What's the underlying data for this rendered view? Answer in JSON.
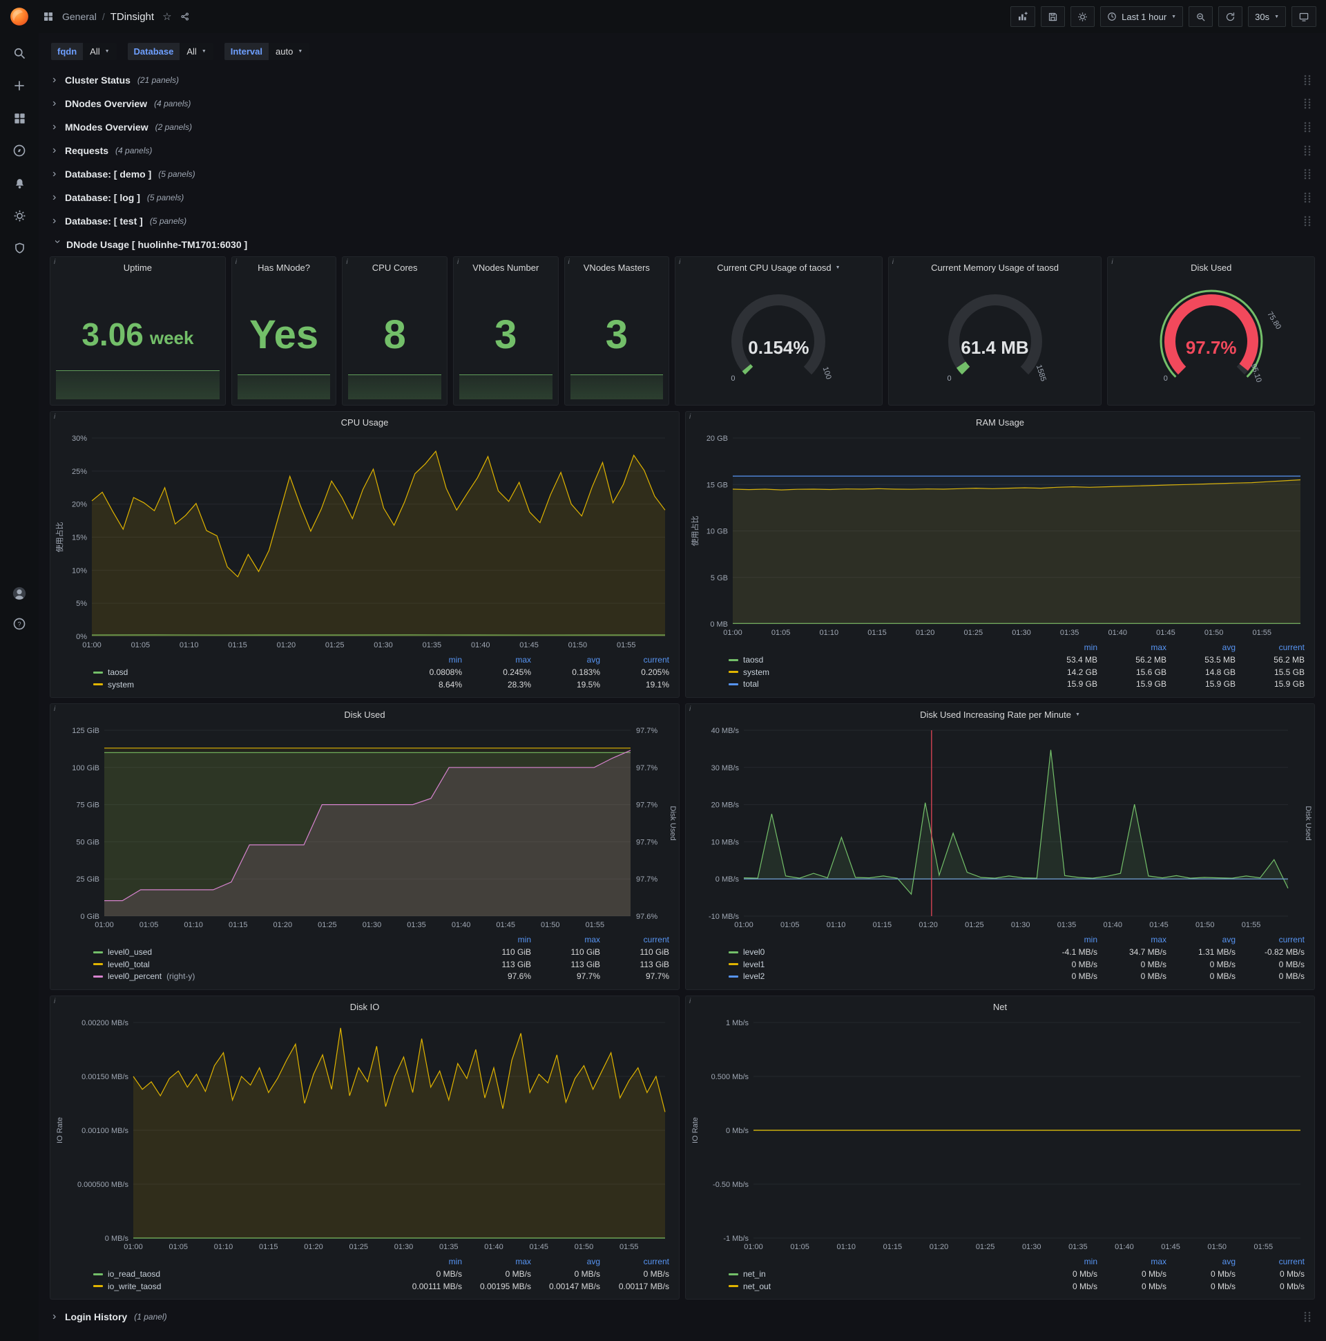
{
  "nav": {
    "breadcrumb_section": "General",
    "breadcrumb_sep": "/",
    "breadcrumb_page": "TDinsight",
    "time_range": "Last 1 hour",
    "refresh_interval": "30s"
  },
  "variables": [
    {
      "label": "fqdn",
      "value": "All"
    },
    {
      "label": "Database",
      "value": "All"
    },
    {
      "label": "Interval",
      "value": "auto"
    }
  ],
  "rows": [
    {
      "title": "Cluster Status",
      "count": "(21 panels)"
    },
    {
      "title": "DNodes Overview",
      "count": "(4 panels)"
    },
    {
      "title": "MNodes Overview",
      "count": "(2 panels)"
    },
    {
      "title": "Requests",
      "count": "(4 panels)"
    },
    {
      "title": "Database: [ demo ]",
      "count": "(5 panels)"
    },
    {
      "title": "Database: [ log ]",
      "count": "(5 panels)"
    },
    {
      "title": "Database: [ test ]",
      "count": "(5 panels)"
    }
  ],
  "expanded_row": {
    "title": "DNode Usage [ huolinhe-TM1701:6030 ]"
  },
  "login_row": {
    "title": "Login History",
    "count": "(1 panel)"
  },
  "stats": [
    {
      "title": "Uptime",
      "value": "3.06",
      "unit": "week",
      "spark_h": 42
    },
    {
      "title": "Has MNode?",
      "value": "Yes",
      "spark_h": 36
    },
    {
      "title": "CPU Cores",
      "value": "8",
      "spark_h": 36
    },
    {
      "title": "VNodes Number",
      "value": "3",
      "spark_h": 36
    },
    {
      "title": "VNodes Masters",
      "value": "3",
      "spark_h": 36
    }
  ],
  "gauges": [
    {
      "title": "Current CPU Usage of taosd",
      "caret": true,
      "value": "0.154%",
      "min_label": "0",
      "max_label": "100",
      "pct": 0.0155,
      "arc_color": "#73bf69",
      "value_color": "#e0e2e4"
    },
    {
      "title": "Current Memory Usage of taosd",
      "value": "61.4 MB",
      "min_label": "0",
      "max_label": "1585",
      "pct": 0.039,
      "arc_color": "#73bf69",
      "value_color": "#e0e2e4"
    },
    {
      "title": "Disk Used",
      "value": "97.7%",
      "min_label": "0",
      "max_label": "95.10",
      "threshold_label": "75.80",
      "pct": 0.977,
      "arc_color": "#f2495c",
      "value_color": "#f2495c",
      "ring_color": "#73bf69"
    }
  ],
  "time_ticks": [
    "01:00",
    "01:05",
    "01:10",
    "01:15",
    "01:20",
    "01:25",
    "01:30",
    "01:35",
    "01:40",
    "01:45",
    "01:50",
    "01:55"
  ],
  "chart_data": [
    {
      "type": "line",
      "title": "CPU Usage",
      "ylabel": "使用占比",
      "y_min": 0,
      "y_max": 30,
      "y_ticks": [
        {
          "v": 0,
          "label": "0%"
        },
        {
          "v": 5,
          "label": "5%"
        },
        {
          "v": 10,
          "label": "10%"
        },
        {
          "v": 15,
          "label": "15%"
        },
        {
          "v": 20,
          "label": "20%"
        },
        {
          "v": 25,
          "label": "25%"
        },
        {
          "v": 30,
          "label": "30%"
        }
      ],
      "legend_cols": [
        "min",
        "max",
        "avg",
        "current"
      ],
      "series": [
        {
          "name": "taosd",
          "color": "#73bf69",
          "fo": 0.1,
          "values": [
            0.2,
            0.21,
            0.19,
            0.2,
            0.2,
            0.21,
            0.2,
            0.19,
            0.2,
            0.2
          ],
          "legend": [
            "0.0808%",
            "0.245%",
            "0.183%",
            "0.205%"
          ]
        },
        {
          "name": "system",
          "color": "#e0b400",
          "fo": 0.12,
          "values": [
            20.5,
            21.8,
            18.9,
            16.2,
            21,
            20.2,
            19,
            22.5,
            17,
            18.3,
            20.1,
            16,
            15.2,
            10.5,
            9,
            12.4,
            9.8,
            13,
            18.6,
            24.2,
            19.8,
            15.9,
            19.2,
            23.5,
            21,
            17.8,
            22.2,
            25.3,
            19.4,
            16.8,
            20.3,
            24.6,
            26.1,
            28,
            22.4,
            19.1,
            21.6,
            24,
            27.2,
            22,
            20.4,
            23.3,
            18.8,
            17.2,
            21.4,
            24.8,
            20,
            18.2,
            22.6,
            26.3,
            20.2,
            23,
            27.4,
            25.1,
            21.2,
            19.1
          ],
          "legend": [
            "8.64%",
            "28.3%",
            "19.5%",
            "19.1%"
          ]
        }
      ]
    },
    {
      "type": "line",
      "title": "RAM Usage",
      "ylabel": "使用占比",
      "y_min": 0,
      "y_max": 20,
      "y_ticks": [
        {
          "v": 0,
          "label": "0 MB"
        },
        {
          "v": 5,
          "label": "5 GB"
        },
        {
          "v": 10,
          "label": "10 GB"
        },
        {
          "v": 15,
          "label": "15 GB"
        },
        {
          "v": 20,
          "label": "20 GB"
        }
      ],
      "legend_cols": [
        "min",
        "max",
        "avg",
        "current"
      ],
      "series": [
        {
          "name": "taosd",
          "color": "#73bf69",
          "fo": 0.1,
          "values": [
            0.053,
            0.053,
            0.053,
            0.053,
            0.053,
            0.053
          ],
          "legend": [
            "53.4 MB",
            "56.2 MB",
            "53.5 MB",
            "56.2 MB"
          ]
        },
        {
          "name": "system",
          "color": "#e0b400",
          "fo": 0.1,
          "values": [
            14.5,
            14.45,
            14.5,
            14.42,
            14.48,
            14.5,
            14.46,
            14.52,
            14.5,
            14.55,
            14.5,
            14.48,
            14.52,
            14.5,
            14.55,
            14.6,
            14.55,
            14.6,
            14.65,
            14.6,
            14.7,
            14.75,
            14.7,
            14.75,
            14.8,
            14.85,
            14.9,
            14.95,
            15,
            15.05,
            15.1,
            15.15,
            15.2,
            15.3,
            15.4,
            15.5
          ],
          "legend": [
            "14.2 GB",
            "15.6 GB",
            "14.8 GB",
            "15.5 GB"
          ]
        },
        {
          "name": "total",
          "color": "#5794f2",
          "fo": 0.05,
          "values": [
            15.9,
            15.9,
            15.9,
            15.9,
            15.9,
            15.9
          ],
          "legend": [
            "15.9 GB",
            "15.9 GB",
            "15.9 GB",
            "15.9 GB"
          ]
        }
      ]
    },
    {
      "type": "line",
      "title": "Disk Used",
      "y2label": "Disk Used",
      "y_min": 0,
      "y_max": 125,
      "y_ticks": [
        {
          "v": 0,
          "label": "0 GiB"
        },
        {
          "v": 25,
          "label": "25 GiB"
        },
        {
          "v": 50,
          "label": "50 GiB"
        },
        {
          "v": 75,
          "label": "75 GiB"
        },
        {
          "v": 100,
          "label": "100 GiB"
        },
        {
          "v": 125,
          "label": "125 GiB"
        }
      ],
      "y2_min": 97.59,
      "y2_max": 97.71,
      "y2_ticks": [
        {
          "v": 97.59,
          "label": "97.6%"
        },
        {
          "v": 97.614,
          "label": "97.7%"
        },
        {
          "v": 97.638,
          "label": "97.7%"
        },
        {
          "v": 97.662,
          "label": "97.7%"
        },
        {
          "v": 97.686,
          "label": "97.7%"
        },
        {
          "v": 97.71,
          "label": "97.7%"
        }
      ],
      "legend_cols": [
        "min",
        "max",
        "current"
      ],
      "series": [
        {
          "name": "level0_used",
          "color": "#73bf69",
          "fo": 0.12,
          "values": [
            110,
            110,
            110,
            110,
            110,
            110
          ],
          "legend": [
            "110 GiB",
            "110 GiB",
            "110 GiB"
          ]
        },
        {
          "name": "level0_total",
          "color": "#e0b400",
          "fo": 0.06,
          "values": [
            113,
            113,
            113,
            113,
            113,
            113
          ],
          "legend": [
            "113 GiB",
            "113 GiB",
            "113 GiB"
          ]
        },
        {
          "name": "level0_percent",
          "suffix": "(right-y)",
          "color": "#d683ce",
          "fo": 0.13,
          "axis": 2,
          "values": [
            97.6,
            97.6,
            97.607,
            97.607,
            97.607,
            97.607,
            97.607,
            97.612,
            97.636,
            97.636,
            97.636,
            97.636,
            97.662,
            97.662,
            97.662,
            97.662,
            97.662,
            97.662,
            97.666,
            97.686,
            97.686,
            97.686,
            97.686,
            97.686,
            97.686,
            97.686,
            97.686,
            97.686,
            97.692,
            97.697
          ],
          "legend": [
            "97.6%",
            "97.7%",
            "97.7%"
          ]
        }
      ]
    },
    {
      "type": "line",
      "title": "Disk Used Increasing Rate per Minute",
      "caret": true,
      "y2label": "Disk Used",
      "y_min": -10,
      "y_max": 40,
      "y_ticks": [
        {
          "v": -10,
          "label": "-10 MB/s"
        },
        {
          "v": 0,
          "label": "0 MB/s"
        },
        {
          "v": 10,
          "label": "10 MB/s"
        },
        {
          "v": 20,
          "label": "20 MB/s"
        },
        {
          "v": 30,
          "label": "30 MB/s"
        },
        {
          "v": 40,
          "label": "40 MB/s"
        }
      ],
      "annotation_x_frac": 0.345,
      "annotation_color": "#f2495c",
      "legend_cols": [
        "min",
        "max",
        "avg",
        "current"
      ],
      "series": [
        {
          "name": "level0",
          "color": "#73bf69",
          "fo": 0.12,
          "values": [
            0.3,
            0.2,
            17.5,
            0.8,
            0.2,
            1.5,
            0.3,
            11.2,
            0.4,
            0.3,
            0.8,
            0.2,
            -4.1,
            20.5,
            1,
            12.3,
            1.8,
            0.4,
            0.2,
            0.8,
            0.3,
            0.2,
            34.7,
            0.9,
            0.4,
            0.2,
            0.7,
            1.5,
            20.1,
            0.8,
            0.3,
            0.9,
            0.2,
            0.4,
            0.3,
            0.2,
            0.8,
            0.3,
            5.2,
            -2.5
          ],
          "legend": [
            "-4.1 MB/s",
            "34.7 MB/s",
            "1.31 MB/s",
            "-0.82 MB/s"
          ]
        },
        {
          "name": "level1",
          "color": "#e0b400",
          "fo": 0,
          "values": [
            0,
            0,
            0,
            0,
            0,
            0
          ],
          "legend": [
            "0 MB/s",
            "0 MB/s",
            "0 MB/s",
            "0 MB/s"
          ]
        },
        {
          "name": "level2",
          "color": "#5794f2",
          "fo": 0,
          "values": [
            0,
            0,
            0,
            0,
            0,
            0
          ],
          "legend": [
            "0 MB/s",
            "0 MB/s",
            "0 MB/s",
            "0 MB/s"
          ]
        }
      ]
    },
    {
      "type": "line",
      "title": "Disk IO",
      "ylabel": "IO Rate",
      "y_min": 0,
      "y_max": 0.002,
      "y_ticks": [
        {
          "v": 0,
          "label": "0 MB/s"
        },
        {
          "v": 0.0005,
          "label": "0.000500 MB/s"
        },
        {
          "v": 0.001,
          "label": "0.00100 MB/s"
        },
        {
          "v": 0.0015,
          "label": "0.00150 MB/s"
        },
        {
          "v": 0.002,
          "label": "0.00200 MB/s"
        }
      ],
      "legend_cols": [
        "min",
        "max",
        "avg",
        "current"
      ],
      "series": [
        {
          "name": "io_read_taosd",
          "color": "#73bf69",
          "fo": 0,
          "values": [
            0,
            0,
            0,
            0,
            0,
            0
          ],
          "legend": [
            "0 MB/s",
            "0 MB/s",
            "0 MB/s",
            "0 MB/s"
          ]
        },
        {
          "name": "io_write_taosd",
          "color": "#e0b400",
          "fo": 0.12,
          "values": [
            0.0015,
            0.00138,
            0.00145,
            0.00132,
            0.00148,
            0.00155,
            0.0014,
            0.00152,
            0.00136,
            0.0016,
            0.00172,
            0.00128,
            0.0015,
            0.00142,
            0.00158,
            0.00135,
            0.00148,
            0.00165,
            0.0018,
            0.00125,
            0.00152,
            0.0017,
            0.00138,
            0.00195,
            0.00132,
            0.00158,
            0.00145,
            0.00178,
            0.00122,
            0.0015,
            0.00168,
            0.00135,
            0.00185,
            0.0014,
            0.00155,
            0.00128,
            0.00162,
            0.00148,
            0.00175,
            0.0013,
            0.00158,
            0.0012,
            0.00165,
            0.0019,
            0.00135,
            0.00152,
            0.00144,
            0.0017,
            0.00126,
            0.00148,
            0.0016,
            0.00138,
            0.00155,
            0.00172,
            0.0013,
            0.00146,
            0.00158,
            0.00135,
            0.0015,
            0.00117
          ],
          "legend": [
            "0.00111 MB/s",
            "0.00195 MB/s",
            "0.00147 MB/s",
            "0.00117 MB/s"
          ]
        }
      ]
    },
    {
      "type": "line",
      "title": "Net",
      "ylabel": "IO Rate",
      "y_min": -1,
      "y_max": 1,
      "y_ticks": [
        {
          "v": -1,
          "label": "-1 Mb/s"
        },
        {
          "v": -0.5,
          "label": "-0.50 Mb/s"
        },
        {
          "v": 0,
          "label": "0 Mb/s"
        },
        {
          "v": 0.5,
          "label": "0.500 Mb/s"
        },
        {
          "v": 1,
          "label": "1 Mb/s"
        }
      ],
      "legend_cols": [
        "min",
        "max",
        "avg",
        "current"
      ],
      "series": [
        {
          "name": "net_in",
          "color": "#73bf69",
          "fo": 0,
          "values": [
            0,
            0,
            0,
            0,
            0,
            0
          ],
          "legend": [
            "0 Mb/s",
            "0 Mb/s",
            "0 Mb/s",
            "0 Mb/s"
          ]
        },
        {
          "name": "net_out",
          "color": "#e0b400",
          "fo": 0,
          "values": [
            0,
            0,
            0,
            0,
            0,
            0
          ],
          "legend": [
            "0 Mb/s",
            "0 Mb/s",
            "0 Mb/s",
            "0 Mb/s"
          ]
        }
      ]
    }
  ]
}
